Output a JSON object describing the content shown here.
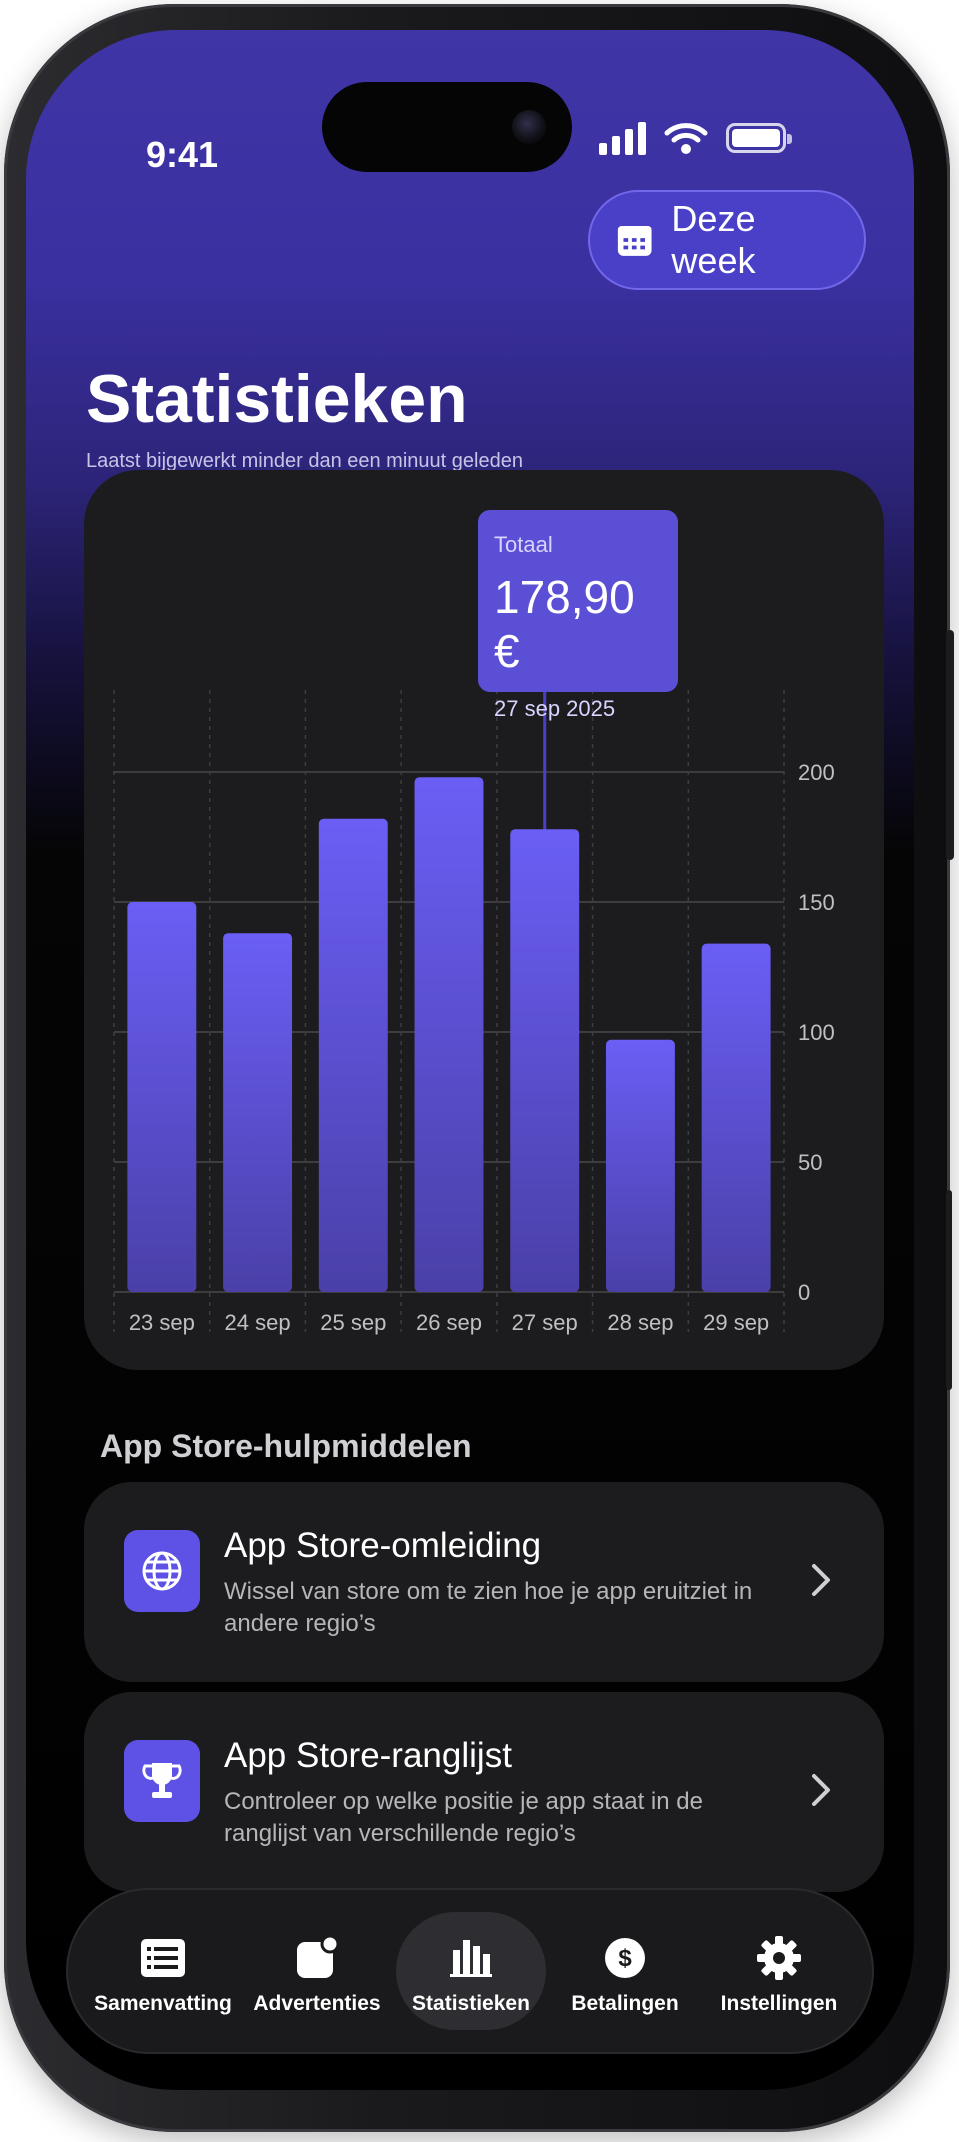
{
  "status_bar": {
    "time": "9:41"
  },
  "header": {
    "period_button": {
      "label": "Deze week",
      "icon": "calendar-icon"
    },
    "title": "Statistieken",
    "subtitle": "Laatst bijgewerkt minder dan een minuut geleden"
  },
  "tooltip": {
    "label": "Totaal",
    "value": "178,90 €",
    "date": "27 sep 2025"
  },
  "chart_data": {
    "type": "bar",
    "categories": [
      "23 sep",
      "24 sep",
      "25 sep",
      "26 sep",
      "27 sep",
      "28 sep",
      "29 sep"
    ],
    "values": [
      150,
      138,
      182,
      198,
      178,
      97,
      134
    ],
    "ylim": [
      0,
      220
    ],
    "yticks": [
      0,
      50,
      100,
      150,
      200
    ],
    "y_axis_position": "right",
    "grid": true,
    "selected_category": "27 sep",
    "bar_color": "#6a5ef5"
  },
  "tools": {
    "section_title": "App Store-hulpmiddelen",
    "items": [
      {
        "title": "App Store-omleiding",
        "description": "Wissel van store om te zien hoe je app eruitziet in andere regio’s",
        "icon": "globe-icon"
      },
      {
        "title": "App Store-ranglijst",
        "description": "Controleer op welke positie je app staat in de ranglijst van verschillende regio’s",
        "icon": "trophy-icon"
      }
    ]
  },
  "tabbar": {
    "items": [
      {
        "label": "Samenvatting",
        "icon": "list-icon",
        "active": false
      },
      {
        "label": "Advertenties",
        "icon": "ad-badge-icon",
        "active": false
      },
      {
        "label": "Statistieken",
        "icon": "bar-chart-icon",
        "active": true
      },
      {
        "label": "Betalingen",
        "icon": "dollar-icon",
        "active": false
      },
      {
        "label": "Instellingen",
        "icon": "gear-icon",
        "active": false
      }
    ]
  },
  "colors": {
    "accent": "#5e52e6",
    "card": "#1c1c1e",
    "header_gradient_top": "#3f35a6"
  }
}
